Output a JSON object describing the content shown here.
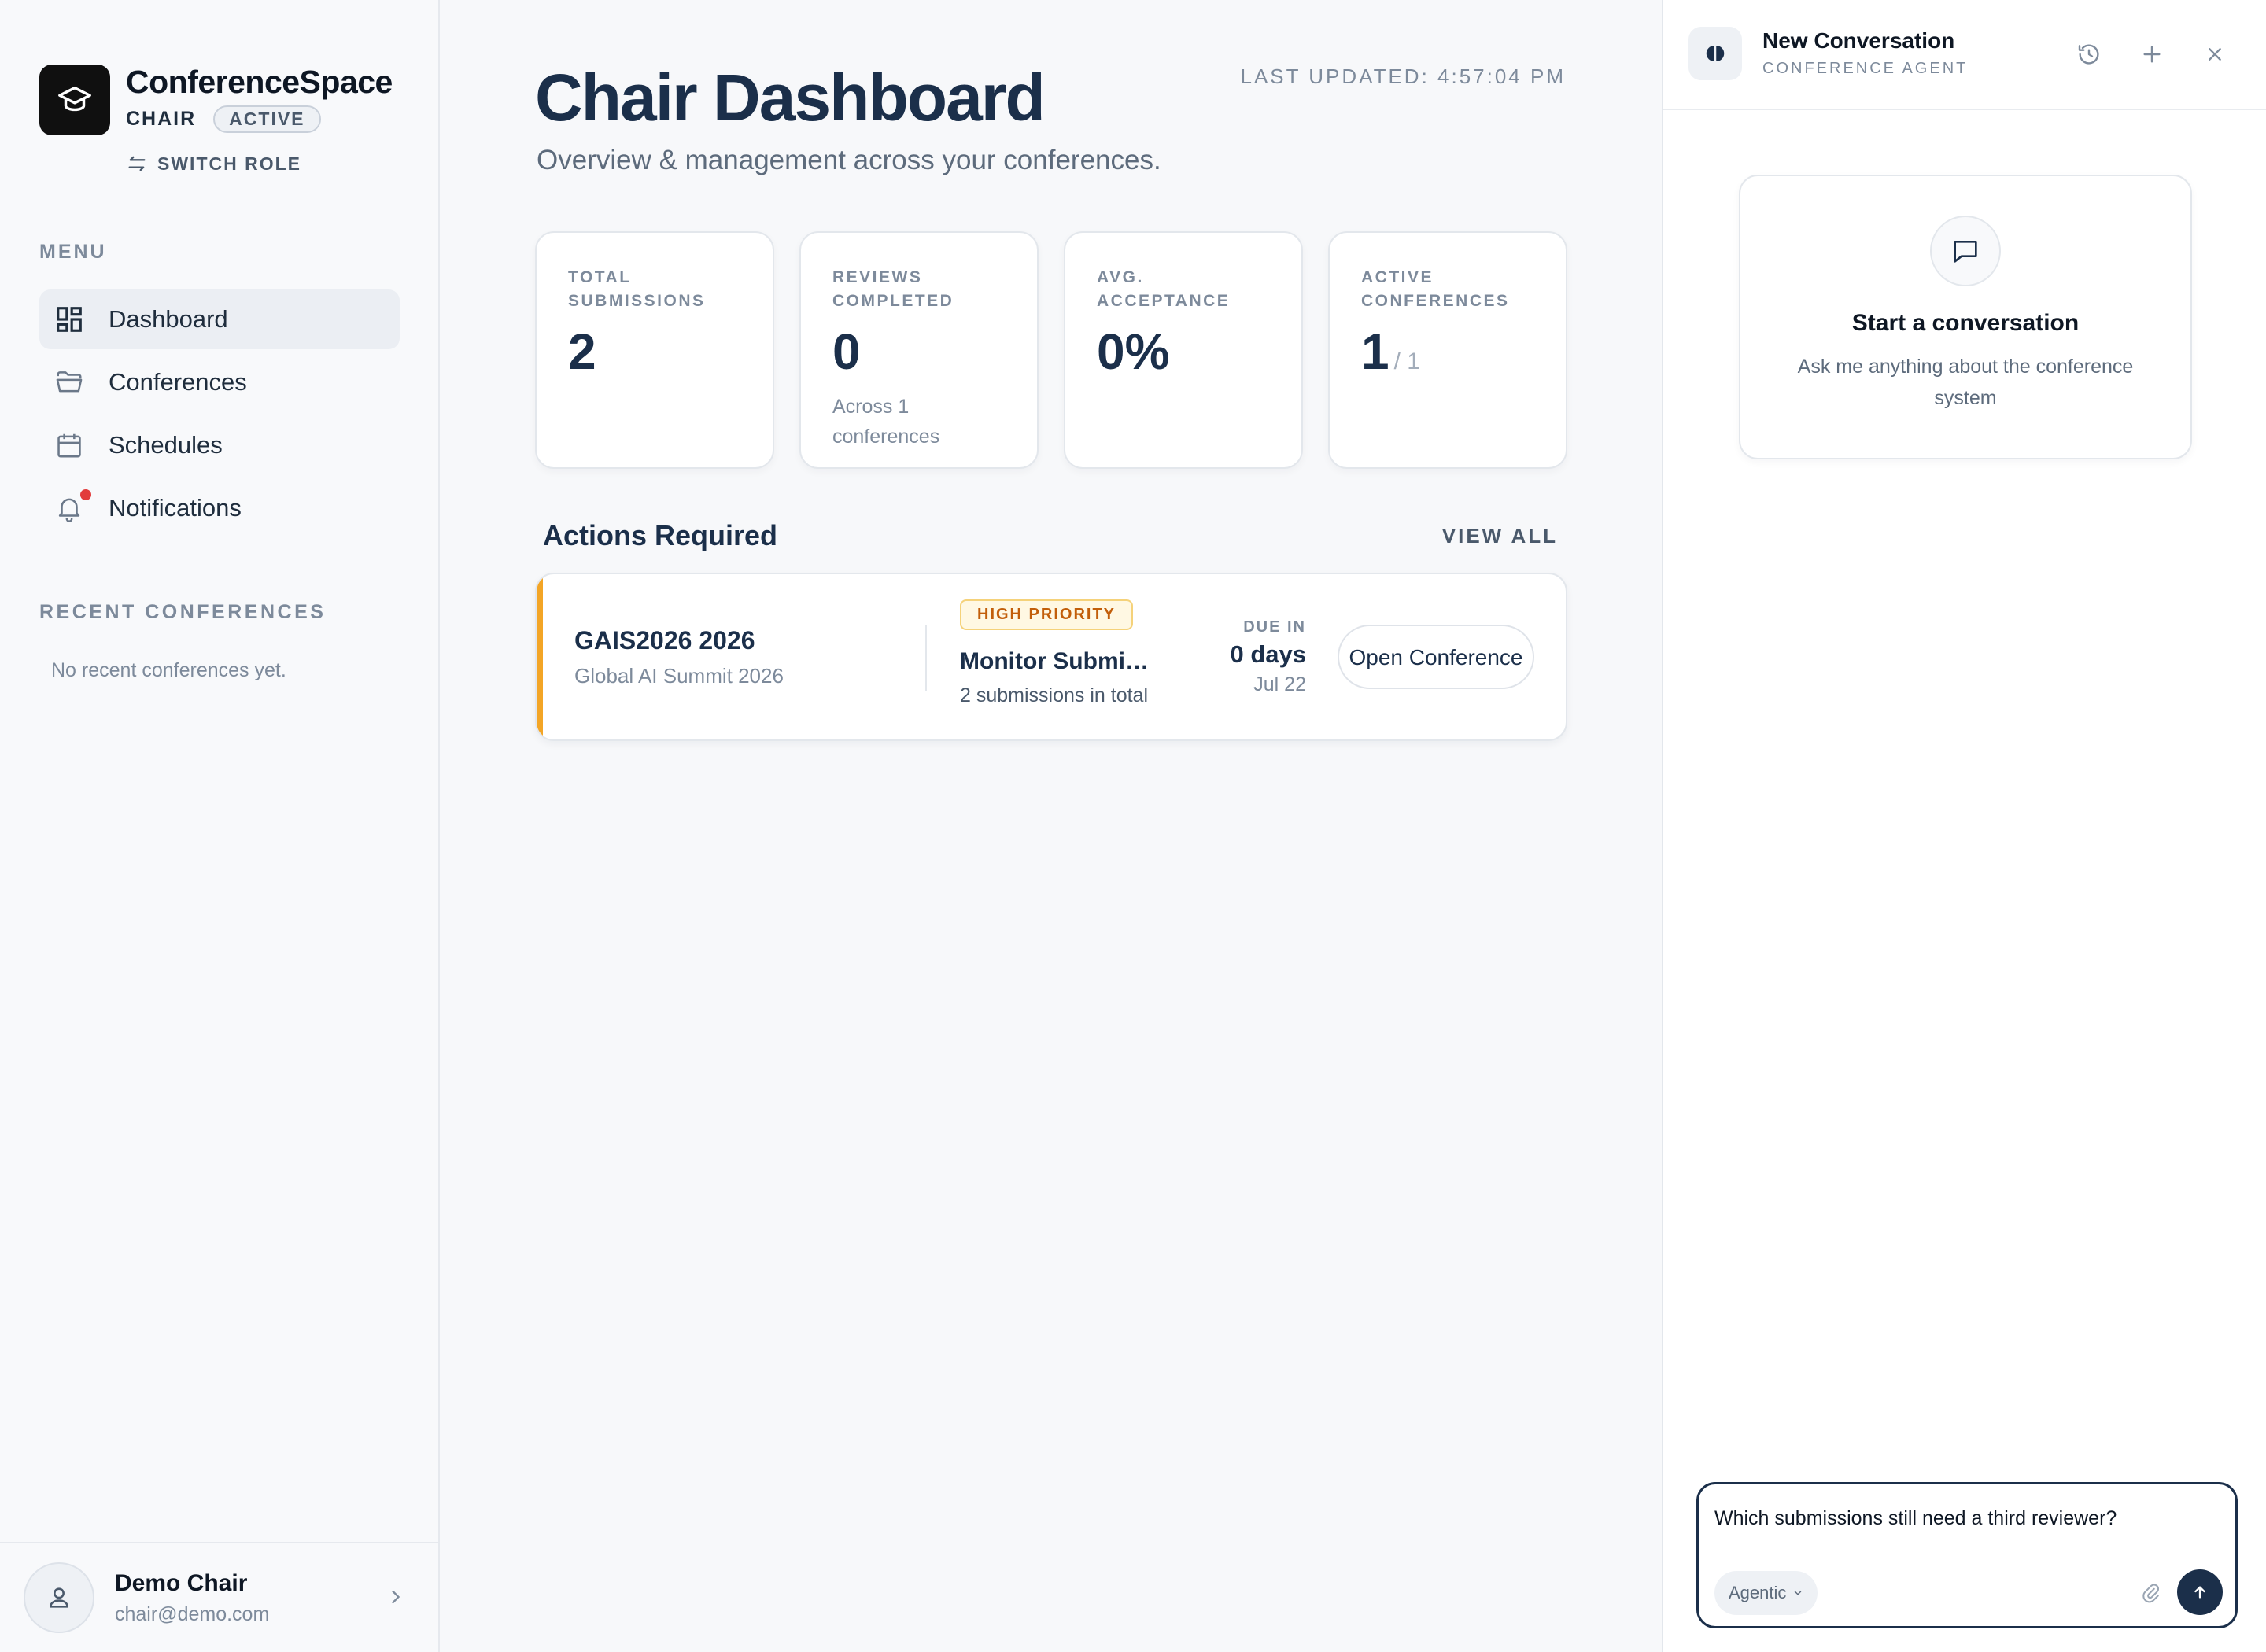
{
  "brand": {
    "name": "ConferenceSpace",
    "role": "CHAIR",
    "role_status": "ACTIVE",
    "switch_role_label": "SWITCH ROLE",
    "logo_icon": "graduation-cap-icon"
  },
  "sidebar": {
    "menu_heading": "MENU",
    "items": [
      {
        "label": "Dashboard",
        "icon": "dashboard-icon",
        "active": true
      },
      {
        "label": "Conferences",
        "icon": "folder-icon",
        "active": false
      },
      {
        "label": "Schedules",
        "icon": "calendar-icon",
        "active": false
      },
      {
        "label": "Notifications",
        "icon": "bell-icon",
        "active": false,
        "has_unread": true
      }
    ],
    "recent_heading": "RECENT CONFERENCES",
    "recent_empty": "No recent conferences yet."
  },
  "user": {
    "name": "Demo Chair",
    "email": "chair@demo.com"
  },
  "header": {
    "title": "Chair Dashboard",
    "subtitle": "Overview & management across your conferences.",
    "last_updated": "LAST UPDATED: 4:57:04 PM"
  },
  "stats": [
    {
      "label_line1": "TOTAL",
      "label_line2": "SUBMISSIONS",
      "value": "2",
      "suffix": "",
      "note": ""
    },
    {
      "label_line1": "REVIEWS",
      "label_line2": "COMPLETED",
      "value": "0",
      "suffix": "",
      "note": "Across 1 conferences"
    },
    {
      "label_line1": "AVG.",
      "label_line2": "ACCEPTANCE",
      "value": "0%",
      "suffix": "",
      "note": ""
    },
    {
      "label_line1": "ACTIVE",
      "label_line2": "CONFERENCES",
      "value": "1",
      "suffix": "/ 1",
      "note": ""
    }
  ],
  "actions": {
    "title": "Actions Required",
    "view_all": "VIEW ALL",
    "items": [
      {
        "code": "GAIS2026 2026",
        "name": "Global AI Summit 2026",
        "priority": "HIGH PRIORITY",
        "task": "Monitor Submissions",
        "detail": "2 submissions in total",
        "due_label": "DUE IN",
        "due_value": "0 days",
        "due_date": "Jul 22",
        "button": "Open Conference",
        "accent_color": "#f3a526"
      }
    ]
  },
  "chat": {
    "title": "New Conversation",
    "subtitle": "CONFERENCE AGENT",
    "empty_title": "Start a conversation",
    "empty_text": "Ask me anything about the conference system",
    "input_value": "Which submissions still need a third reviewer?",
    "mode": "Agentic",
    "header_icons": [
      "history-icon",
      "plus-icon",
      "close-icon"
    ]
  },
  "colors": {
    "primary": "#1b2f4a",
    "accent_warning": "#f3a526",
    "priority_text": "#c25e0a",
    "notification_dot": "#e23b3b"
  }
}
